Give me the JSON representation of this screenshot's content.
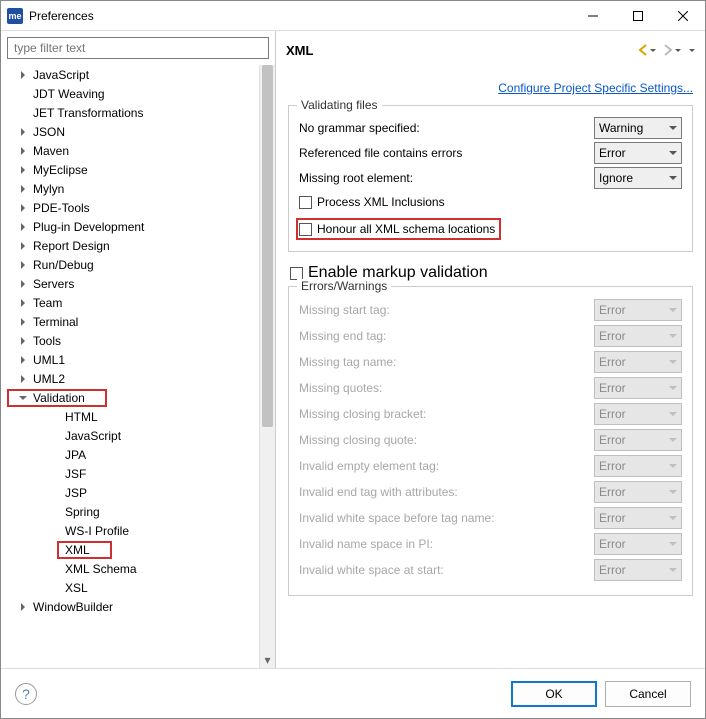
{
  "window": {
    "title": "Preferences",
    "app_icon_text": "me"
  },
  "filter": {
    "placeholder": "type filter text"
  },
  "tree": {
    "items": [
      {
        "label": "JavaScript",
        "depth": 1,
        "expand": "collapsed"
      },
      {
        "label": "JDT Weaving",
        "depth": 1,
        "expand": "none"
      },
      {
        "label": "JET Transformations",
        "depth": 1,
        "expand": "none"
      },
      {
        "label": "JSON",
        "depth": 1,
        "expand": "collapsed"
      },
      {
        "label": "Maven",
        "depth": 1,
        "expand": "collapsed"
      },
      {
        "label": "MyEclipse",
        "depth": 1,
        "expand": "collapsed"
      },
      {
        "label": "Mylyn",
        "depth": 1,
        "expand": "collapsed"
      },
      {
        "label": "PDE-Tools",
        "depth": 1,
        "expand": "collapsed"
      },
      {
        "label": "Plug-in Development",
        "depth": 1,
        "expand": "collapsed"
      },
      {
        "label": "Report Design",
        "depth": 1,
        "expand": "collapsed"
      },
      {
        "label": "Run/Debug",
        "depth": 1,
        "expand": "collapsed"
      },
      {
        "label": "Servers",
        "depth": 1,
        "expand": "collapsed"
      },
      {
        "label": "Team",
        "depth": 1,
        "expand": "collapsed"
      },
      {
        "label": "Terminal",
        "depth": 1,
        "expand": "collapsed"
      },
      {
        "label": "Tools",
        "depth": 1,
        "expand": "collapsed"
      },
      {
        "label": "UML1",
        "depth": 1,
        "expand": "collapsed"
      },
      {
        "label": "UML2",
        "depth": 1,
        "expand": "collapsed"
      },
      {
        "label": "Validation",
        "depth": 1,
        "expand": "expanded",
        "highlight": true
      },
      {
        "label": "HTML",
        "depth": 2,
        "expand": "none"
      },
      {
        "label": "JavaScript",
        "depth": 2,
        "expand": "none"
      },
      {
        "label": "JPA",
        "depth": 2,
        "expand": "none"
      },
      {
        "label": "JSF",
        "depth": 2,
        "expand": "none"
      },
      {
        "label": "JSP",
        "depth": 2,
        "expand": "none"
      },
      {
        "label": "Spring",
        "depth": 2,
        "expand": "none"
      },
      {
        "label": "WS-I Profile",
        "depth": 2,
        "expand": "none"
      },
      {
        "label": "XML",
        "depth": 2,
        "expand": "none",
        "highlight": true
      },
      {
        "label": "XML Schema",
        "depth": 2,
        "expand": "none"
      },
      {
        "label": "XSL",
        "depth": 2,
        "expand": "none"
      },
      {
        "label": "WindowBuilder",
        "depth": 1,
        "expand": "collapsed"
      }
    ]
  },
  "right": {
    "title": "XML",
    "config_link": "Configure Project Specific Settings...",
    "validating": {
      "legend": "Validating files",
      "no_grammar": {
        "label": "No grammar specified:",
        "value": "Warning"
      },
      "ref_errors": {
        "label": "Referenced file contains errors",
        "value": "Error"
      },
      "missing_root": {
        "label": "Missing root element:",
        "value": "Ignore"
      },
      "process_xml": "Process XML Inclusions",
      "honour": "Honour all XML schema locations"
    },
    "enable_markup": "Enable markup validation",
    "errors": {
      "legend": "Errors/Warnings",
      "rows": [
        {
          "label": "Missing start tag:",
          "value": "Error"
        },
        {
          "label": "Missing end tag:",
          "value": "Error"
        },
        {
          "label": "Missing tag name:",
          "value": "Error"
        },
        {
          "label": "Missing quotes:",
          "value": "Error"
        },
        {
          "label": "Missing closing bracket:",
          "value": "Error"
        },
        {
          "label": "Missing closing quote:",
          "value": "Error"
        },
        {
          "label": "Invalid empty element tag:",
          "value": "Error"
        },
        {
          "label": "Invalid end tag with attributes:",
          "value": "Error"
        },
        {
          "label": "Invalid white space before tag name:",
          "value": "Error"
        },
        {
          "label": "Invalid name space in PI:",
          "value": "Error"
        },
        {
          "label": "Invalid white space at start:",
          "value": "Error"
        }
      ]
    }
  },
  "footer": {
    "ok": "OK",
    "cancel": "Cancel"
  }
}
